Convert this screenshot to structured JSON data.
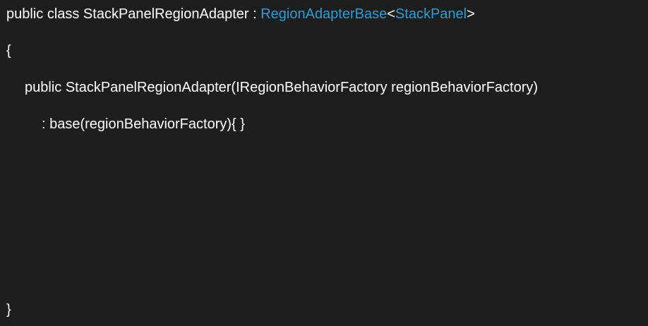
{
  "code": {
    "line1": {
      "prefix": "public class StackPanelRegionAdapter : ",
      "base_type": "RegionAdapterBase",
      "lt": "<",
      "generic_arg": "StackPanel",
      "gt": ">"
    },
    "line2": "{",
    "line3": "public StackPanelRegionAdapter(IRegionBehaviorFactory regionBehaviorFactory)",
    "line4": ": base(regionBehaviorFactory){ }",
    "line5": "}"
  },
  "colors": {
    "background": "#1e1e1e",
    "text": "#ffffff",
    "type_reference": "#2a9fd6"
  }
}
